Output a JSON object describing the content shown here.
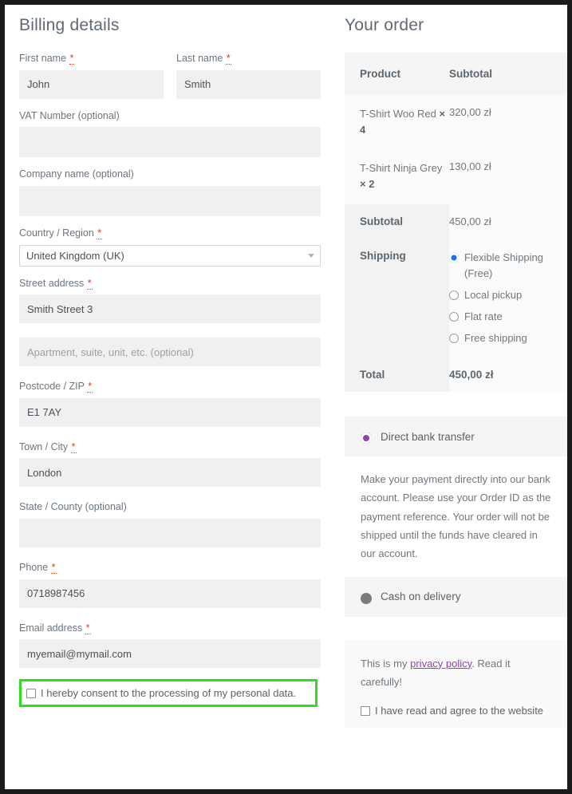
{
  "billing": {
    "title": "Billing details",
    "fields": [
      {
        "label": "First name",
        "required": true,
        "value": "John",
        "placeholder": ""
      },
      {
        "label": "Last name",
        "required": true,
        "value": "Smith",
        "placeholder": ""
      },
      {
        "label": "VAT Number (optional)",
        "required": false,
        "value": "",
        "placeholder": ""
      },
      {
        "label": "Company name (optional)",
        "required": false,
        "value": "",
        "placeholder": ""
      },
      {
        "label": "Country / Region",
        "required": true,
        "value": "United Kingdom (UK)",
        "placeholder": ""
      },
      {
        "label": "Street address",
        "required": true,
        "value": "Smith Street 3",
        "placeholder": ""
      },
      {
        "label": "",
        "required": false,
        "value": "",
        "placeholder": "Apartment, suite, unit, etc. (optional)"
      },
      {
        "label": "Postcode / ZIP",
        "required": true,
        "value": "E1 7AY",
        "placeholder": ""
      },
      {
        "label": "Town / City",
        "required": true,
        "value": "London",
        "placeholder": ""
      },
      {
        "label": "State / County (optional)",
        "required": false,
        "value": "",
        "placeholder": ""
      },
      {
        "label": "Phone",
        "required": true,
        "value": "0718987456",
        "placeholder": ""
      },
      {
        "label": "Email address",
        "required": true,
        "value": "myemail@mymail.com",
        "placeholder": ""
      }
    ],
    "consent": {
      "label": "I hereby consent to the processing of my personal data.",
      "checked": false,
      "highlight_color": "#31dd22"
    }
  },
  "order": {
    "title": "Your order",
    "table": {
      "headers": {
        "product": "Product",
        "subtotal": "Subtotal"
      },
      "items": [
        {
          "name": "T-Shirt Woo Red",
          "qty": "× 4",
          "subtotal": "320,00 zł"
        },
        {
          "name": "T-Shirt Ninja Grey",
          "qty": "× 2",
          "subtotal": "130,00 zł"
        }
      ],
      "subtotal_label": "Subtotal",
      "subtotal_value": "450,00 zł",
      "shipping_label": "Shipping",
      "shipping_options": [
        {
          "label": "Flexible Shipping (Free)",
          "selected": true
        },
        {
          "label": "Local pickup",
          "selected": false
        },
        {
          "label": "Flat rate",
          "selected": false
        },
        {
          "label": "Free shipping",
          "selected": false
        }
      ],
      "total_label": "Total",
      "total_value": "450,00 zł"
    },
    "payment": {
      "methods": [
        {
          "label": "Direct bank transfer",
          "selected": true,
          "style": "purple"
        },
        {
          "label": "Cash on delivery",
          "selected": false,
          "style": "gray"
        }
      ],
      "description": "Make your payment directly into our bank account. Please use your Order ID as the payment reference. Your order will not be shipped until the funds have cleared in our account."
    },
    "privacy": {
      "text_before": "This is my ",
      "link": "privacy policy",
      "text_after": ". Read it carefully!",
      "terms_label": "I have read and agree to the website",
      "terms_checked": false
    }
  },
  "colors": {
    "required_asterisk": "#e2401c",
    "radio_blue": "#1a73e8",
    "radio_purple": "#8e44ad",
    "link_purple": "#8e44ad",
    "highlight_green": "#31dd22"
  }
}
